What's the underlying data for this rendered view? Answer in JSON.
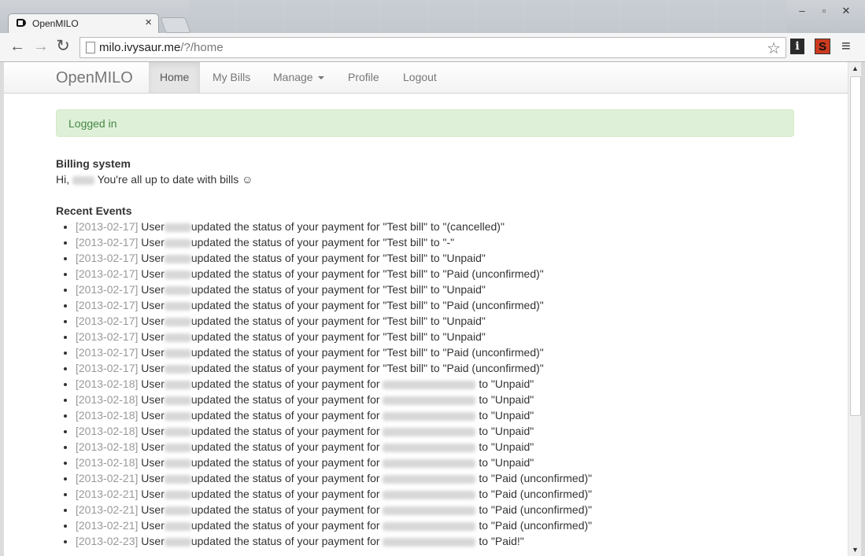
{
  "browser": {
    "tab_title": "OpenMILO",
    "tab_close": "×",
    "url_host": "milo.ivysaur.me",
    "url_path": "/?/home",
    "window_controls": [
      "–",
      "▫",
      "✕"
    ]
  },
  "navbar": {
    "brand": "OpenMILO",
    "items": [
      "Home",
      "My Bills",
      "Manage",
      "Profile",
      "Logout"
    ]
  },
  "alert": {
    "text": "Logged in"
  },
  "billing": {
    "title": "Billing system",
    "greeting_prefix": "Hi,",
    "greeting_suffix": "You're all up to date with bills ☺"
  },
  "recent": {
    "title": "Recent Events",
    "events": [
      {
        "date": "[2013-02-17]",
        "a": "User",
        "b": "updated the status of your payment for \"Test bill\" to \"(cancelled)\""
      },
      {
        "date": "[2013-02-17]",
        "a": "User",
        "b": "updated the status of your payment for \"Test bill\" to \"-\""
      },
      {
        "date": "[2013-02-17]",
        "a": "User",
        "b": "updated the status of your payment for \"Test bill\" to \"Unpaid\""
      },
      {
        "date": "[2013-02-17]",
        "a": "User",
        "b": "updated the status of your payment for \"Test bill\" to \"Paid (unconfirmed)\""
      },
      {
        "date": "[2013-02-17]",
        "a": "User",
        "b": "updated the status of your payment for \"Test bill\" to \"Unpaid\""
      },
      {
        "date": "[2013-02-17]",
        "a": "User",
        "b": "updated the status of your payment for \"Test bill\" to \"Paid (unconfirmed)\""
      },
      {
        "date": "[2013-02-17]",
        "a": "User",
        "b": "updated the status of your payment for \"Test bill\" to \"Unpaid\""
      },
      {
        "date": "[2013-02-17]",
        "a": "User",
        "b": "updated the status of your payment for \"Test bill\" to \"Unpaid\""
      },
      {
        "date": "[2013-02-17]",
        "a": "User",
        "b": "updated the status of your payment for \"Test bill\" to \"Paid (unconfirmed)\""
      },
      {
        "date": "[2013-02-17]",
        "a": "User",
        "b": "updated the status of your payment for \"Test bill\" to \"Paid (unconfirmed)\""
      },
      {
        "date": "[2013-02-18]",
        "a": "User",
        "b": "updated the status of your payment for",
        "c": "to \"Unpaid\""
      },
      {
        "date": "[2013-02-18]",
        "a": "User",
        "b": "updated the status of your payment for",
        "c": "to \"Unpaid\""
      },
      {
        "date": "[2013-02-18]",
        "a": "User",
        "b": "updated the status of your payment for",
        "c": "to \"Unpaid\""
      },
      {
        "date": "[2013-02-18]",
        "a": "User",
        "b": "updated the status of your payment for",
        "c": "to \"Unpaid\""
      },
      {
        "date": "[2013-02-18]",
        "a": "User",
        "b": "updated the status of your payment for",
        "c": "to \"Unpaid\""
      },
      {
        "date": "[2013-02-18]",
        "a": "User",
        "b": "updated the status of your payment for",
        "c": "to \"Unpaid\""
      },
      {
        "date": "[2013-02-21]",
        "a": "User",
        "b": "updated the status of your payment for",
        "c": "to \"Paid (unconfirmed)\""
      },
      {
        "date": "[2013-02-21]",
        "a": "User",
        "b": "updated the status of your payment for",
        "c": "to \"Paid (unconfirmed)\""
      },
      {
        "date": "[2013-02-21]",
        "a": "User",
        "b": "updated the status of your payment for",
        "c": "to \"Paid (unconfirmed)\""
      },
      {
        "date": "[2013-02-21]",
        "a": "User",
        "b": "updated the status of your payment for",
        "c": "to \"Paid (unconfirmed)\""
      },
      {
        "date": "[2013-02-23]",
        "a": "User",
        "b": "updated the status of your payment for",
        "c": "to \"Paid!\""
      }
    ]
  }
}
